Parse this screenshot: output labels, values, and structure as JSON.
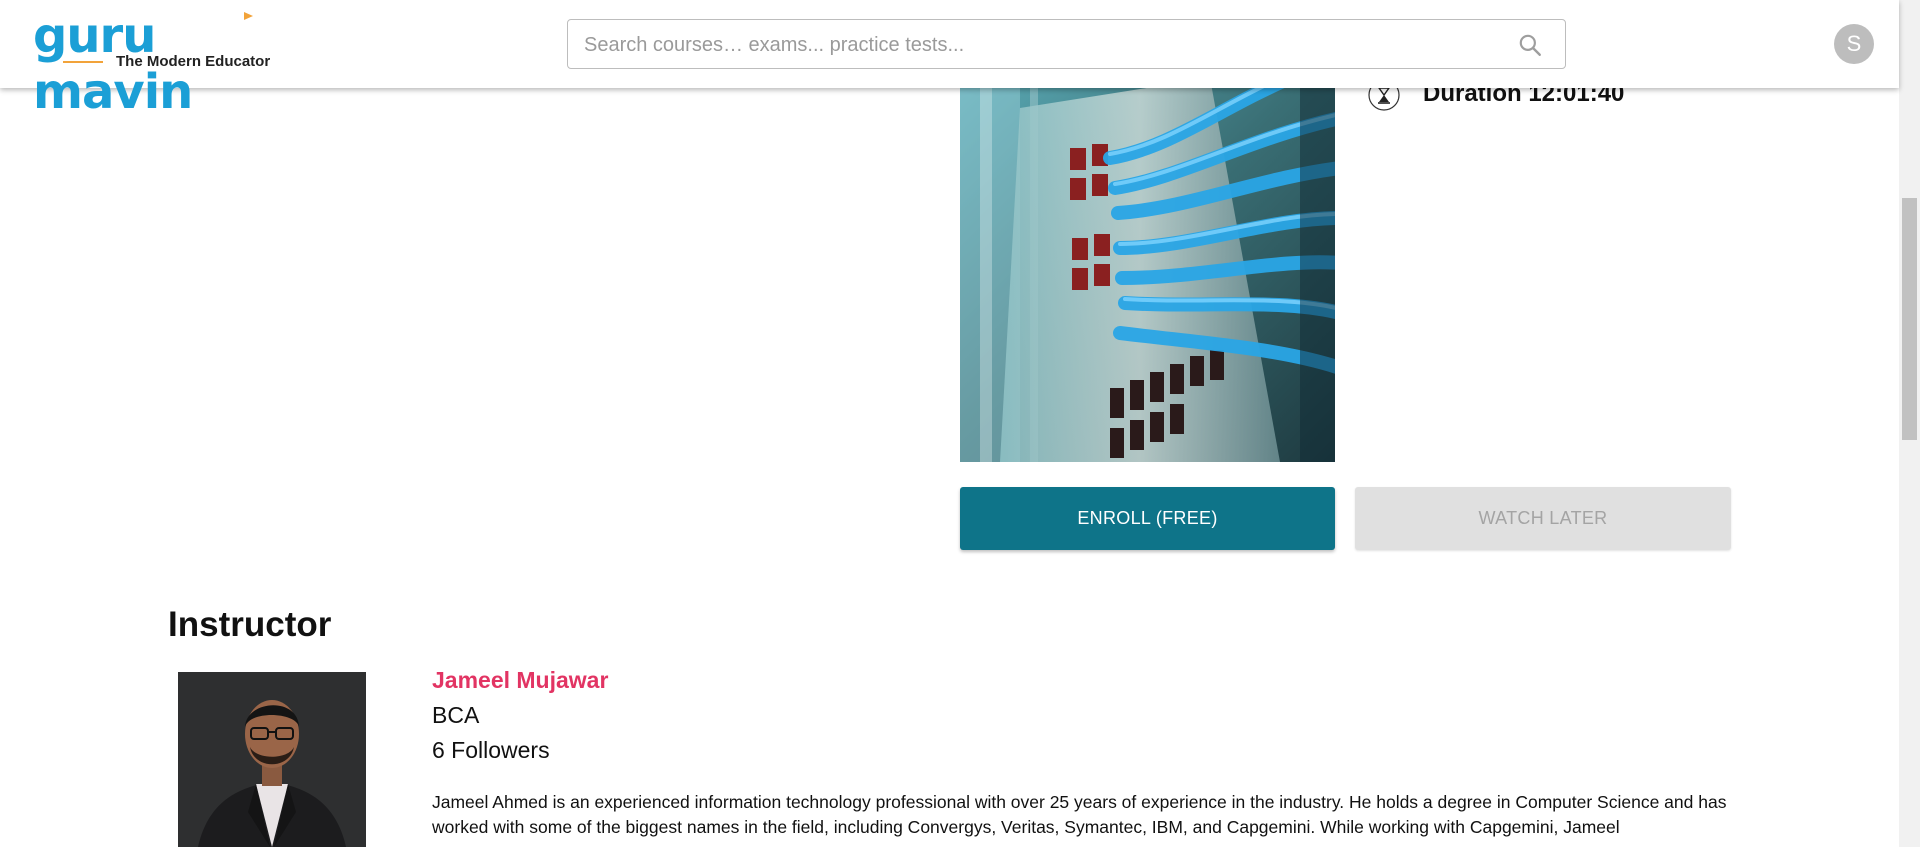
{
  "header": {
    "logo_text": "guru mavin",
    "logo_tagline": "The Modern Educator",
    "search_placeholder": "Search courses… exams... practice tests...",
    "avatar_initial": "S"
  },
  "course": {
    "duration_label": "Duration 12:01:40",
    "enroll_label": "ENROLL (FREE)",
    "watch_later_label": "WATCH LATER"
  },
  "instructor": {
    "heading": "Instructor",
    "name": "Jameel Mujawar",
    "degree": "BCA",
    "followers": "6 Followers",
    "bio": "Jameel Ahmed is an experienced information technology professional with over 25 years of experience in the industry. He holds a degree in Computer Science and has worked with some of the biggest names in the field, including Convergys, Veritas, Symantec, IBM, and Capgemini. While working with Capgemini, Jameel"
  },
  "colors": {
    "brand_blue": "#1b9fd6",
    "brand_orange": "#f2a33a",
    "enroll_teal": "#0e7489",
    "instructor_name_pink": "#e23463"
  },
  "icons": {
    "search": "search-icon",
    "duration": "hourglass-icon"
  }
}
